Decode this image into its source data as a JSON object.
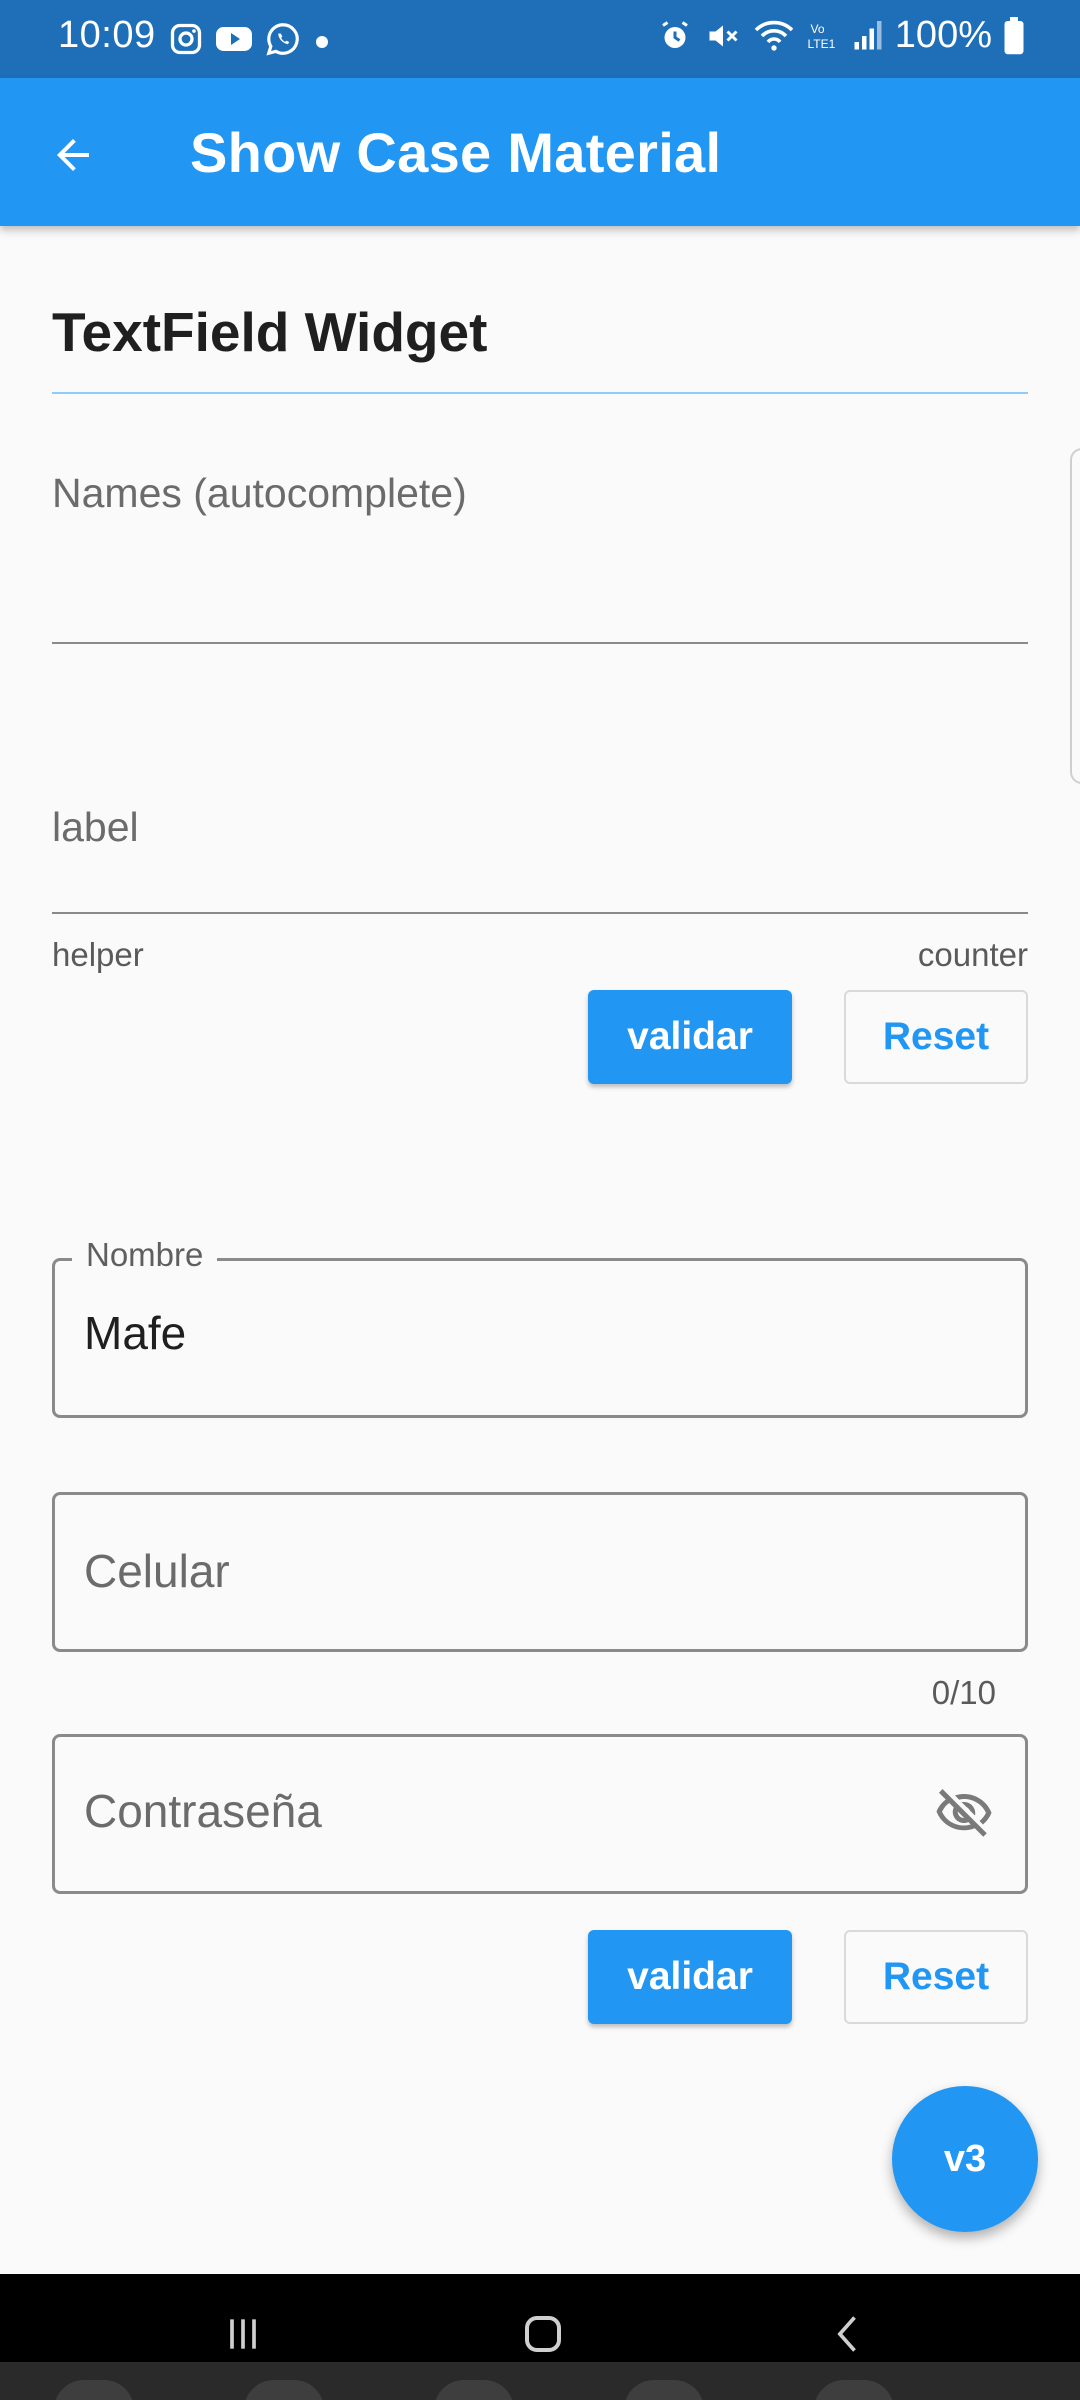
{
  "status_bar": {
    "time": "10:09",
    "battery": "100%",
    "left_icons": [
      "instagram-icon",
      "youtube-icon",
      "whatsapp-icon",
      "dot-icon"
    ],
    "right_icons": [
      "alarm-icon",
      "mute-icon",
      "wifi-icon",
      "volte-icon",
      "signal-icon",
      "battery-icon"
    ]
  },
  "app_bar": {
    "title": "Show Case Material",
    "back_icon": "arrow-back-icon",
    "background": "#2196f3"
  },
  "section": {
    "title": "TextField Widget"
  },
  "form1": {
    "names_label": "Names (autocomplete)",
    "label_field_label": "label",
    "helper": "helper",
    "counter": "counter",
    "validate_button": "validar",
    "reset_button": "Reset"
  },
  "form2": {
    "nombre_label": "Nombre",
    "nombre_value": "Mafe",
    "celular_placeholder": "Celular",
    "celular_counter": "0/10",
    "password_placeholder": "Contraseña",
    "password_icon": "visibility-off-icon",
    "validate_button": "validar",
    "reset_button": "Reset"
  },
  "fab": {
    "label": "v3"
  },
  "nav_bar": {
    "icons": [
      "recent-apps-icon",
      "home-icon",
      "back-icon"
    ]
  },
  "colors": {
    "primary": "#2196f3",
    "status_bar": "#1e6fb8",
    "background": "#fafafa"
  }
}
